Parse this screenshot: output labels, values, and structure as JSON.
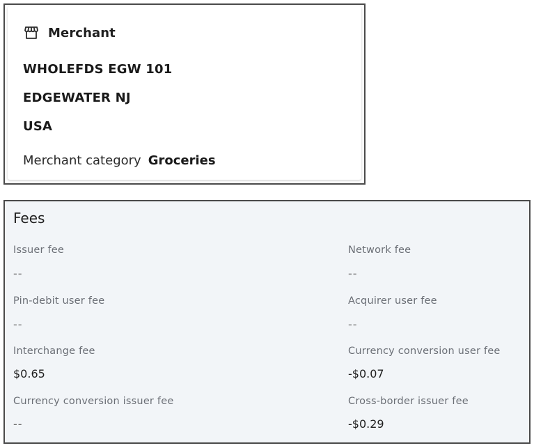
{
  "merchant": {
    "title": "Merchant",
    "icon": "store-icon",
    "name": "WHOLEFDS EGW 101",
    "city_state": "EDGEWATER NJ",
    "country": "USA",
    "category_label": "Merchant category",
    "category_value": "Groceries"
  },
  "fees": {
    "title": "Fees",
    "items": [
      {
        "label": "Issuer fee",
        "value": "--"
      },
      {
        "label": "Network fee",
        "value": "--"
      },
      {
        "label": "Pin-debit user fee",
        "value": "--"
      },
      {
        "label": "Acquirer user fee",
        "value": "--"
      },
      {
        "label": "Interchange fee",
        "value": "$0.65"
      },
      {
        "label": "Currency conversion user fee",
        "value": "-$0.07"
      },
      {
        "label": "Currency conversion issuer fee",
        "value": "--"
      },
      {
        "label": "Cross-border issuer fee",
        "value": "-$0.29"
      }
    ]
  }
}
